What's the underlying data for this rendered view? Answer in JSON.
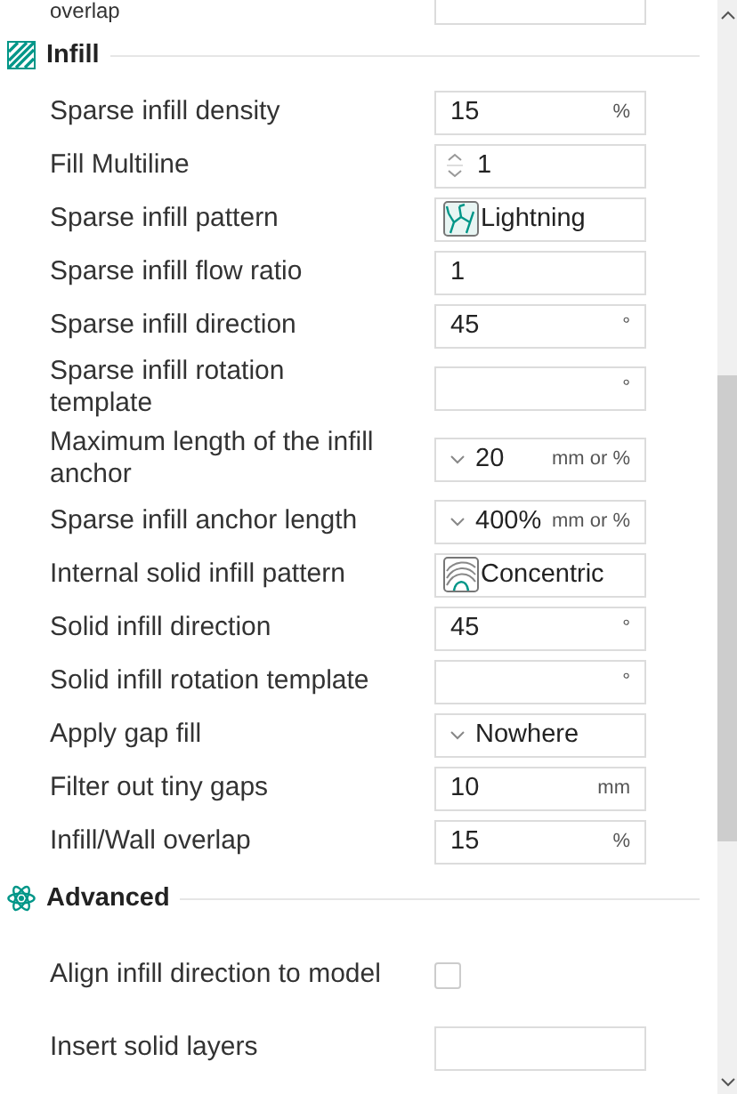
{
  "previous_row": {
    "label": "overlap"
  },
  "sections": [
    {
      "title": "Infill",
      "rows": [
        {
          "label": "Sparse infill density",
          "kind": "text",
          "value": "15",
          "unit": "%"
        },
        {
          "label": "Fill Multiline",
          "kind": "spin",
          "value": "1"
        },
        {
          "label": "Sparse infill pattern",
          "kind": "pattern",
          "value": "Lightning"
        },
        {
          "label": "Sparse infill flow ratio",
          "kind": "text",
          "value": "1"
        },
        {
          "label": "Sparse infill direction",
          "kind": "text",
          "value": "45",
          "unit": "°"
        },
        {
          "label": "Sparse infill rotation template",
          "kind": "text",
          "unit": "°"
        },
        {
          "label": "Maximum length of the infill anchor",
          "kind": "combo",
          "value": "20",
          "unit": "mm or %"
        },
        {
          "label": "Sparse infill anchor length",
          "kind": "combo",
          "value": "400%",
          "unit": "mm or %"
        },
        {
          "label": "Internal solid infill pattern",
          "kind": "pattern",
          "value": "Concentric"
        },
        {
          "label": "Solid infill direction",
          "kind": "text",
          "value": "45",
          "unit": "°"
        },
        {
          "label": "Solid infill rotation template",
          "kind": "text",
          "unit": "°"
        },
        {
          "label": "Apply gap fill",
          "kind": "combo",
          "value": "Nowhere"
        },
        {
          "label": "Filter out tiny gaps",
          "kind": "text",
          "value": "10",
          "unit": "mm"
        },
        {
          "label": "Infill/Wall overlap",
          "kind": "text",
          "value": "15",
          "unit": "%"
        }
      ]
    },
    {
      "title": "Advanced",
      "rows": [
        {
          "label": "Align infill direction to model",
          "kind": "check",
          "checked": false
        },
        {
          "label": "Insert solid layers",
          "kind": "text"
        }
      ]
    }
  ]
}
